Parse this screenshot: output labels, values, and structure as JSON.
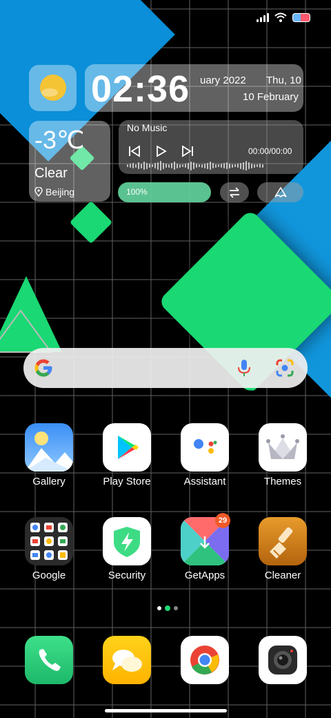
{
  "status": {
    "signal": "signal-bars-icon",
    "wifi": "wifi-icon",
    "battery": "battery-icon"
  },
  "clock": {
    "time": "02:36",
    "date_short": "uary 2022",
    "day": "Thu, 10",
    "date_long": "10 February"
  },
  "weather": {
    "temperature": "-3℃",
    "condition": "Clear",
    "city": "Beijing"
  },
  "music": {
    "title": "No Music",
    "time": "00:00/00:00"
  },
  "quick": {
    "brightness_label": "100%"
  },
  "apps": {
    "row1": [
      {
        "label": "Gallery"
      },
      {
        "label": "Play Store"
      },
      {
        "label": "Assistant"
      },
      {
        "label": "Themes"
      }
    ],
    "row2": [
      {
        "label": "Google"
      },
      {
        "label": "Security"
      },
      {
        "label": "GetApps",
        "badge": "29"
      },
      {
        "label": "Cleaner"
      }
    ]
  },
  "dock": [
    "phone-icon",
    "messaging-icon",
    "chrome-icon",
    "camera-icon"
  ],
  "colors": {
    "accent_green": "#1ad873",
    "accent_blue": "#0a8fd8",
    "badge": "#f05a28"
  }
}
